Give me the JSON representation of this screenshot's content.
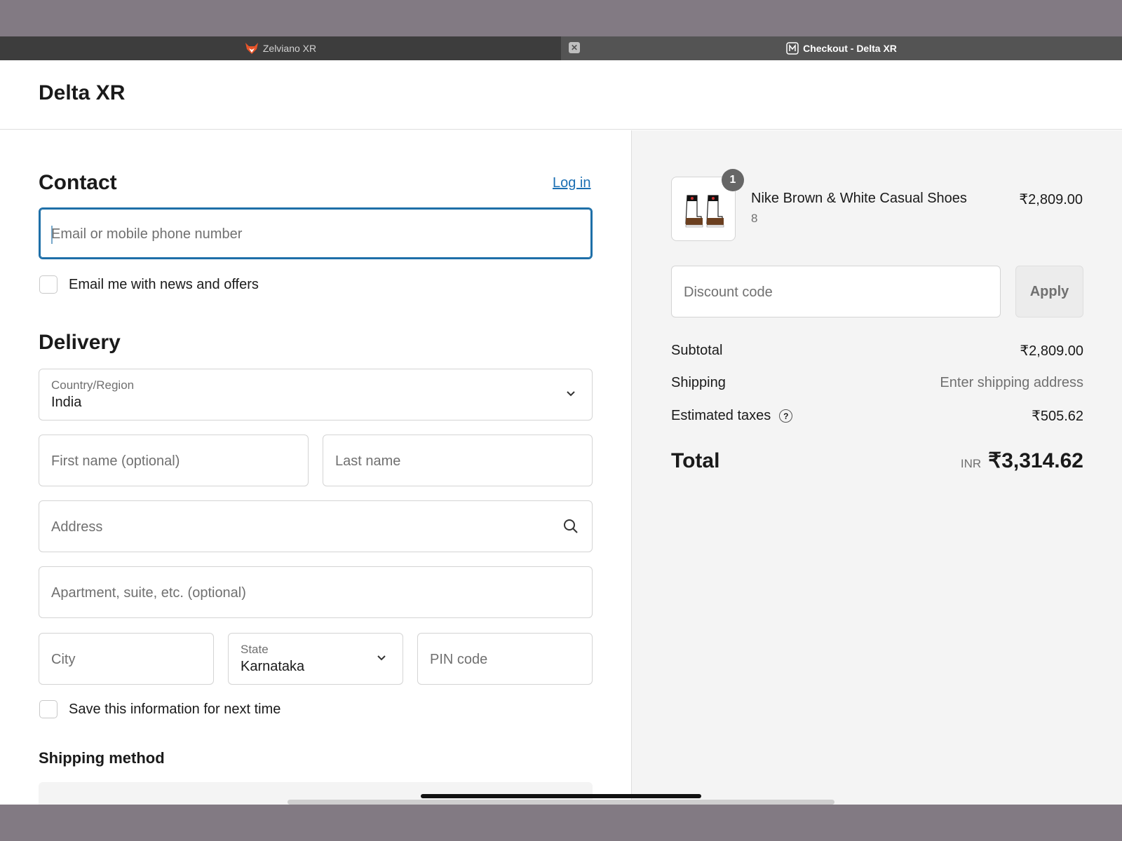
{
  "browser": {
    "tabs": [
      {
        "label": "Zelviano XR",
        "icon": "fox-icon"
      },
      {
        "label": "Checkout - Delta XR",
        "icon": "m-badge-icon"
      }
    ],
    "close_glyph": "✕"
  },
  "store": {
    "name": "Delta XR"
  },
  "contact": {
    "heading": "Contact",
    "login_label": "Log in",
    "email_placeholder": "Email or mobile phone number",
    "news_label": "Email me with news and offers"
  },
  "delivery": {
    "heading": "Delivery",
    "country_label": "Country/Region",
    "country_value": "India",
    "first_name_placeholder": "First name (optional)",
    "last_name_placeholder": "Last name",
    "address_placeholder": "Address",
    "apartment_placeholder": "Apartment, suite, etc. (optional)",
    "city_placeholder": "City",
    "state_label": "State",
    "state_value": "Karnataka",
    "pin_placeholder": "PIN code",
    "save_label": "Save this information for next time"
  },
  "shipping_method": {
    "heading": "Shipping method"
  },
  "summary": {
    "item": {
      "name": "Nike Brown & White Casual Shoes",
      "variant": "8",
      "price": "₹2,809.00",
      "quantity": "1"
    },
    "discount_placeholder": "Discount code",
    "apply_label": "Apply",
    "subtotal_label": "Subtotal",
    "subtotal_value": "₹2,809.00",
    "shipping_label": "Shipping",
    "shipping_value": "Enter shipping address",
    "taxes_label": "Estimated taxes",
    "taxes_help": "?",
    "taxes_value": "₹505.62",
    "total_label": "Total",
    "total_currency": "INR",
    "total_value": "₹3,314.62"
  },
  "colors": {
    "accent": "#1e6fa8",
    "link": "#1b6fb3",
    "summary_bg": "#f4f4f4",
    "tabbar_bg": "#3d3d3d"
  }
}
